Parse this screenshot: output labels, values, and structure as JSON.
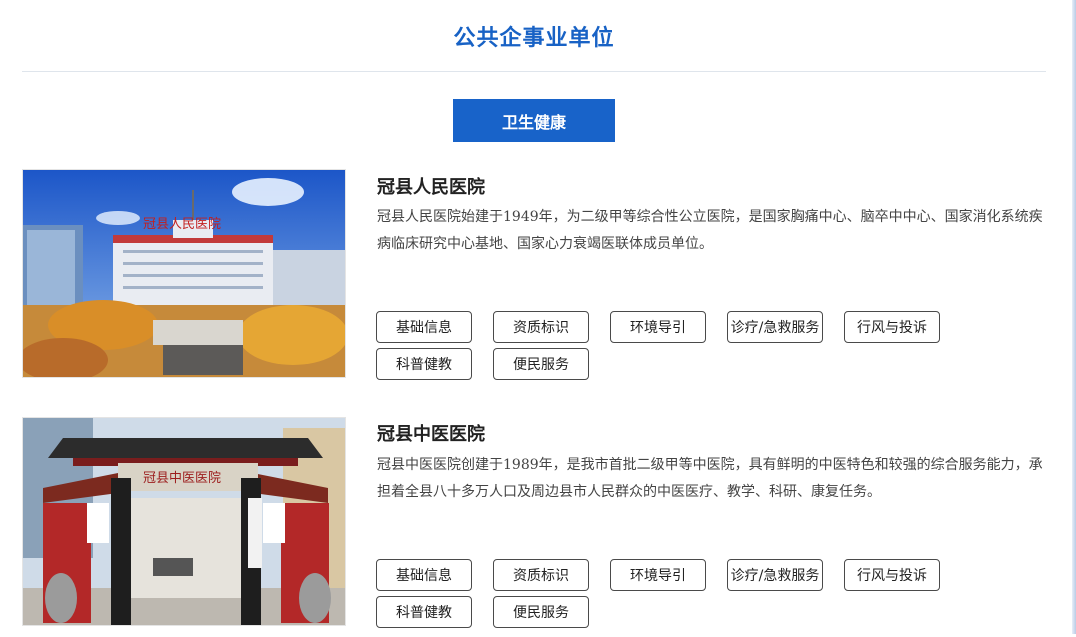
{
  "page": {
    "title": "公共企事业单位"
  },
  "tabs": {
    "active": "卫生健康"
  },
  "units": [
    {
      "name": "冠县人民医院",
      "description": "冠县人民医院始建于1949年，为二级甲等综合性公立医院，是国家胸痛中心、脑卒中中心、国家消化系统疾病临床研究中心基地、国家心力衰竭医联体成员单位。",
      "sign_text": "冠县人民医院",
      "buttons": [
        "基础信息",
        "资质标识",
        "环境导引",
        "诊疗/急救服务",
        "行风与投诉",
        "科普健教",
        "便民服务"
      ]
    },
    {
      "name": "冠县中医医院",
      "description": "冠县中医医院创建于1989年，是我市首批二级甲等中医院，具有鲜明的中医特色和较强的综合服务能力，承担着全县八十多万人口及周边县市人民群众的中医医疗、教学、科研、康复任务。",
      "sign_text": "冠县中医医院",
      "buttons": [
        "基础信息",
        "资质标识",
        "环境导引",
        "诊疗/急救服务",
        "行风与投诉",
        "科普健教",
        "便民服务"
      ]
    }
  ]
}
